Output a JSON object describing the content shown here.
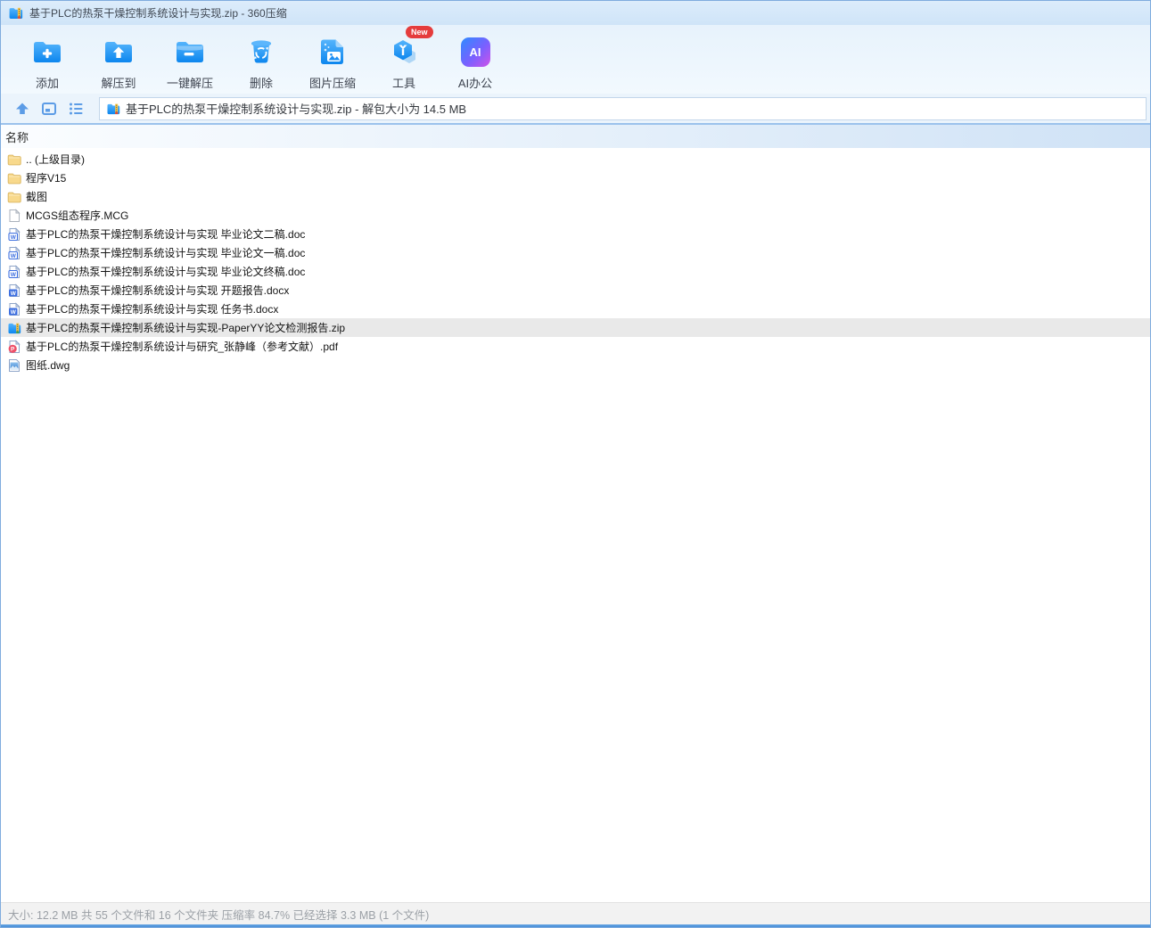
{
  "window": {
    "title": "基于PLC的热泵干燥控制系统设计与实现.zip - 360压缩"
  },
  "colors": {
    "accent_blue": "#1E90F5",
    "titlebar_blue": "#D7E9FA",
    "badge_red": "#E53C3C",
    "folder_yellow": "#F8D98C",
    "selected_row_gray": "#E9E9E9",
    "zipper_yellow": "#F6C64A"
  },
  "toolbar": {
    "items": [
      {
        "label": "添加",
        "icon": "add-folder-icon"
      },
      {
        "label": "解压到",
        "icon": "extract-to-folder-icon"
      },
      {
        "label": "一键解压",
        "icon": "one-click-extract-icon"
      },
      {
        "label": "删除",
        "icon": "delete-trash-icon"
      },
      {
        "label": "图片压缩",
        "icon": "image-compress-icon"
      },
      {
        "label": "工具",
        "icon": "tools-icon",
        "badge": "New"
      },
      {
        "label": "AI办公",
        "icon": "ai-office-icon",
        "icon_text": "AI"
      }
    ]
  },
  "navbar": {
    "icons": [
      "up-icon",
      "view-mode-icon",
      "list-view-icon"
    ],
    "address": "基于PLC的热泵干燥控制系统设计与实现.zip - 解包大小为 14.5 MB"
  },
  "list": {
    "header": "名称",
    "rows": [
      {
        "name": ".. (上级目录)",
        "type": "folder",
        "selected": false
      },
      {
        "name": "程序V15",
        "type": "folder",
        "selected": false
      },
      {
        "name": "截图",
        "type": "folder",
        "selected": false
      },
      {
        "name": "MCGS组态程序.MCG",
        "type": "file",
        "selected": false
      },
      {
        "name": "基于PLC的热泵干燥控制系统设计与实现 毕业论文二稿.doc",
        "type": "doc",
        "selected": false
      },
      {
        "name": "基于PLC的热泵干燥控制系统设计与实现 毕业论文一稿.doc",
        "type": "doc",
        "selected": false
      },
      {
        "name": "基于PLC的热泵干燥控制系统设计与实现 毕业论文终稿.doc",
        "type": "doc",
        "selected": false
      },
      {
        "name": "基于PLC的热泵干燥控制系统设计与实现 开题报告.docx",
        "type": "docx",
        "selected": false
      },
      {
        "name": "基于PLC的热泵干燥控制系统设计与实现 任务书.docx",
        "type": "docx",
        "selected": false
      },
      {
        "name": "基于PLC的热泵干燥控制系统设计与实现-PaperYY论文检测报告.zip",
        "type": "zip",
        "selected": true
      },
      {
        "name": "基于PLC的热泵干燥控制系统设计与研究_张静峰（参考文献）.pdf",
        "type": "pdf",
        "selected": false
      },
      {
        "name": "图纸.dwg",
        "type": "dwg",
        "selected": false
      }
    ]
  },
  "statusbar": {
    "text": "大小: 12.2 MB 共 55 个文件和 16 个文件夹 压缩率 84.7% 已经选择 3.3 MB (1 个文件)"
  }
}
